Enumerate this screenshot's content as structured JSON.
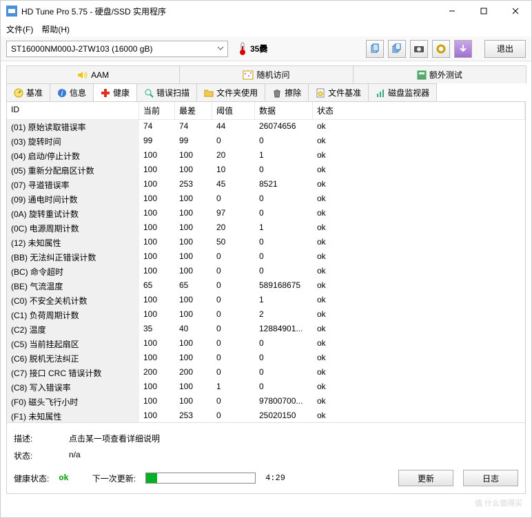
{
  "window": {
    "title": "HD Tune Pro 5.75 - 硬盘/SSD 实用程序"
  },
  "menu": {
    "file": "文件(F)",
    "help": "帮助(H)"
  },
  "toolbar": {
    "drive": "ST16000NM000J-2TW103 (16000 gB)",
    "temp": "35爨",
    "exit": "退出"
  },
  "tabs_top": {
    "aam": "AAM",
    "random": "随机访问",
    "extra": "额外测试"
  },
  "tabs_bottom": {
    "bench": "基准",
    "info": "信息",
    "health": "健康",
    "errscan": "错误扫描",
    "folder": "文件夹使用",
    "erase": "擦除",
    "filebench": "文件基准",
    "monitor": "磁盘监视器"
  },
  "columns": {
    "id": "ID",
    "cur": "当前",
    "worst": "最差",
    "thr": "阈值",
    "data": "数据",
    "stat": "状态"
  },
  "rows": [
    {
      "id": "(01) 原始读取错误率",
      "cur": "74",
      "worst": "74",
      "thr": "44",
      "data": "26074656",
      "stat": "ok"
    },
    {
      "id": "(03) 旋转时间",
      "cur": "99",
      "worst": "99",
      "thr": "0",
      "data": "0",
      "stat": "ok"
    },
    {
      "id": "(04) 启动/停止计数",
      "cur": "100",
      "worst": "100",
      "thr": "20",
      "data": "1",
      "stat": "ok"
    },
    {
      "id": "(05) 重新分配扇区计数",
      "cur": "100",
      "worst": "100",
      "thr": "10",
      "data": "0",
      "stat": "ok"
    },
    {
      "id": "(07) 寻道错误率",
      "cur": "100",
      "worst": "253",
      "thr": "45",
      "data": "8521",
      "stat": "ok"
    },
    {
      "id": "(09) 通电时间计数",
      "cur": "100",
      "worst": "100",
      "thr": "0",
      "data": "0",
      "stat": "ok"
    },
    {
      "id": "(0A) 旋转重试计数",
      "cur": "100",
      "worst": "100",
      "thr": "97",
      "data": "0",
      "stat": "ok"
    },
    {
      "id": "(0C) 电源周期计数",
      "cur": "100",
      "worst": "100",
      "thr": "20",
      "data": "1",
      "stat": "ok"
    },
    {
      "id": "(12) 未知属性",
      "cur": "100",
      "worst": "100",
      "thr": "50",
      "data": "0",
      "stat": "ok"
    },
    {
      "id": "(BB) 无法纠正错误计数",
      "cur": "100",
      "worst": "100",
      "thr": "0",
      "data": "0",
      "stat": "ok"
    },
    {
      "id": "(BC) 命令超时",
      "cur": "100",
      "worst": "100",
      "thr": "0",
      "data": "0",
      "stat": "ok"
    },
    {
      "id": "(BE) 气流温度",
      "cur": "65",
      "worst": "65",
      "thr": "0",
      "data": "589168675",
      "stat": "ok"
    },
    {
      "id": "(C0) 不安全关机计数",
      "cur": "100",
      "worst": "100",
      "thr": "0",
      "data": "1",
      "stat": "ok"
    },
    {
      "id": "(C1) 负荷周期计数",
      "cur": "100",
      "worst": "100",
      "thr": "0",
      "data": "2",
      "stat": "ok"
    },
    {
      "id": "(C2) 温度",
      "cur": "35",
      "worst": "40",
      "thr": "0",
      "data": "12884901...",
      "stat": "ok"
    },
    {
      "id": "(C5) 当前挂起扇区",
      "cur": "100",
      "worst": "100",
      "thr": "0",
      "data": "0",
      "stat": "ok"
    },
    {
      "id": "(C6) 脱机无法纠正",
      "cur": "100",
      "worst": "100",
      "thr": "0",
      "data": "0",
      "stat": "ok"
    },
    {
      "id": "(C7) 接口 CRC 错误计数",
      "cur": "200",
      "worst": "200",
      "thr": "0",
      "data": "0",
      "stat": "ok"
    },
    {
      "id": "(C8) 写入错误率",
      "cur": "100",
      "worst": "100",
      "thr": "1",
      "data": "0",
      "stat": "ok"
    },
    {
      "id": "(F0) 磁头飞行小时",
      "cur": "100",
      "worst": "100",
      "thr": "0",
      "data": "97800700...",
      "stat": "ok"
    },
    {
      "id": "(F1) 未知属性",
      "cur": "100",
      "worst": "253",
      "thr": "0",
      "data": "25020150",
      "stat": "ok"
    }
  ],
  "desc": {
    "label_desc": "描述:",
    "value_desc": "点击某一项查看详细说明",
    "label_stat": "状态:",
    "value_stat": "n/a"
  },
  "bottom": {
    "health_label": "健康状态:",
    "health_value": "ok",
    "next_label": "下一次更新:",
    "timer": "4:29",
    "update": "更新",
    "log": "日志"
  },
  "watermark": "值 什么值得买"
}
